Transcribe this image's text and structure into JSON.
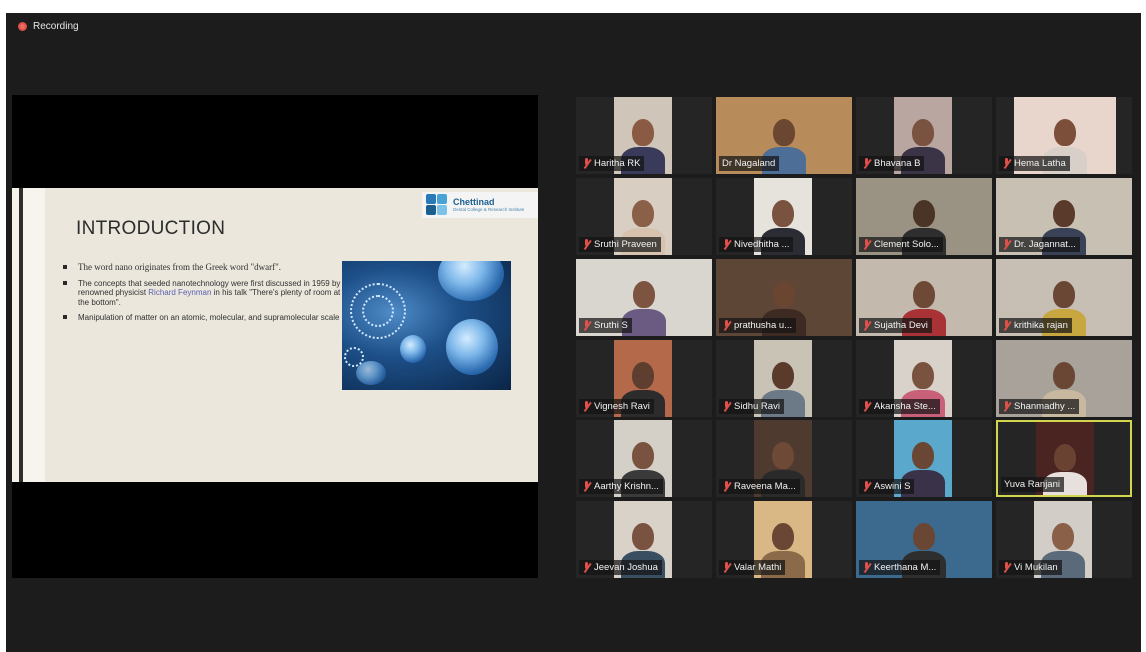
{
  "recording": {
    "label": "Recording"
  },
  "slide": {
    "title": "INTRODUCTION",
    "logo": {
      "name": "Chettinad",
      "subtitle": "Dental College & Research Institute"
    },
    "bullets": [
      {
        "text": "The word nano originates from the Greek word \"dwarf\".",
        "style": "serif"
      },
      {
        "text_before": "The concepts that seeded nanotechnology were first discussed in 1959 by renowned physicist ",
        "link": "Richard Feynman",
        "text_after": " in his talk \"There's plenty of room at the bottom\".",
        "style": "sans"
      },
      {
        "text": "Manipulation of matter on an atomic, molecular, and supramolecular scale",
        "style": "sans"
      }
    ]
  },
  "colors": {
    "background": "#1c1c1c",
    "tile": "#252525",
    "muted_mic": "#e0504a",
    "active_speaker": "#d2d64f"
  },
  "participants": [
    {
      "name": "Haritha RK",
      "muted": true,
      "video": "#cfc5b8",
      "skin": "#8a5a42",
      "shirt": "#3a3a5a",
      "vx": 38,
      "vw": 58
    },
    {
      "name": "Dr Nagaland",
      "muted": false,
      "video": "#b78c5a",
      "skin": "#6b4630",
      "shirt": "#4d6e96",
      "vx": 0,
      "vw": 136
    },
    {
      "name": "Bhavana B",
      "muted": true,
      "video": "#b9a6a0",
      "skin": "#7a5240",
      "shirt": "#3b3346",
      "vx": 38,
      "vw": 58
    },
    {
      "name": "Hema Latha",
      "muted": true,
      "video": "#e8d6cc",
      "skin": "#7b4f3a",
      "shirt": "#d8d0c8",
      "vx": 18,
      "vw": 102
    },
    {
      "name": "Sruthi Praveen",
      "muted": true,
      "video": "#d8cfc2",
      "skin": "#8a6148",
      "shirt": "#d6c2ae",
      "vx": 38,
      "vw": 58
    },
    {
      "name": "Nivedhitha ...",
      "muted": true,
      "video": "#e6e2dc",
      "skin": "#7a5240",
      "shirt": "#2c2c34",
      "vx": 38,
      "vw": 58
    },
    {
      "name": "Clement Solo...",
      "muted": true,
      "video": "#9a9384",
      "skin": "#4a3426",
      "shirt": "#2e2e2e",
      "vx": 0,
      "vw": 136
    },
    {
      "name": "Dr. Jagannat...",
      "muted": true,
      "video": "#c9c0b4",
      "skin": "#5a3a2a",
      "shirt": "#3a4258",
      "vx": 0,
      "vw": 136
    },
    {
      "name": "Sruthi S",
      "muted": true,
      "video": "#d9d6d0",
      "skin": "#7c5440",
      "shirt": "#6b5a82",
      "vx": 0,
      "vw": 136
    },
    {
      "name": "prathusha u...",
      "muted": true,
      "video": "#5e4636",
      "skin": "#6a4532",
      "shirt": "#3d2a22",
      "vx": 0,
      "vw": 136
    },
    {
      "name": "Sujatha Devi",
      "muted": true,
      "video": "#c3b9ac",
      "skin": "#6e4a36",
      "shirt": "#a83236",
      "vx": 0,
      "vw": 136
    },
    {
      "name": "krithika rajan",
      "muted": true,
      "video": "#c7bfb4",
      "skin": "#6a4634",
      "shirt": "#c8a640",
      "vx": 0,
      "vw": 136
    },
    {
      "name": "Vignesh Ravi",
      "muted": true,
      "video": "#b46a4a",
      "skin": "#5e3e2e",
      "shirt": "#2c2c2c",
      "vx": 38,
      "vw": 58
    },
    {
      "name": "Sidhu Ravi",
      "muted": true,
      "video": "#c9c3b6",
      "skin": "#5a3a2a",
      "shirt": "#6b7a86",
      "vx": 38,
      "vw": 58
    },
    {
      "name": "Akansha Ste...",
      "muted": true,
      "video": "#d8d2ca",
      "skin": "#7a5240",
      "shirt": "#c8607a",
      "vx": 38,
      "vw": 58
    },
    {
      "name": "Shanmadhy ...",
      "muted": true,
      "video": "#a8a29a",
      "skin": "#6a4634",
      "shirt": "#c8b8a0",
      "vx": 0,
      "vw": 136
    },
    {
      "name": "Aarthy Krishn...",
      "muted": true,
      "video": "#d4d0c8",
      "skin": "#7a5240",
      "shirt": "#3a3a3a",
      "vx": 38,
      "vw": 58
    },
    {
      "name": "Raveena Ma...",
      "muted": true,
      "video": "#4e3a2e",
      "skin": "#6e4a36",
      "shirt": "#2a2a2a",
      "vx": 38,
      "vw": 58
    },
    {
      "name": "Aswini S",
      "muted": true,
      "video": "#5aa8cc",
      "skin": "#6a4634",
      "shirt": "#3a3248",
      "vx": 38,
      "vw": 58
    },
    {
      "name": "Yuva Ranjani",
      "muted": false,
      "active": true,
      "video": "#4a2420",
      "skin": "#6a4232",
      "shirt": "#e8e0dc",
      "vx": 38,
      "vw": 58
    },
    {
      "name": "Jeevan Joshua",
      "muted": true,
      "video": "#d8d2c8",
      "skin": "#7a5240",
      "shirt": "#3a4e62",
      "vx": 38,
      "vw": 58
    },
    {
      "name": "Valar Mathi",
      "muted": true,
      "video": "#d9b886",
      "skin": "#6a4634",
      "shirt": "#8a6a48",
      "vx": 38,
      "vw": 58
    },
    {
      "name": "Keerthana M...",
      "muted": true,
      "video": "#3c6a8e",
      "skin": "#6a4634",
      "shirt": "#2e2e2e",
      "vx": 0,
      "vw": 136
    },
    {
      "name": "Vi Mukilan",
      "muted": true,
      "video": "#d2cdc6",
      "skin": "#8a6048",
      "shirt": "#5a6a7a",
      "vx": 38,
      "vw": 58
    }
  ]
}
